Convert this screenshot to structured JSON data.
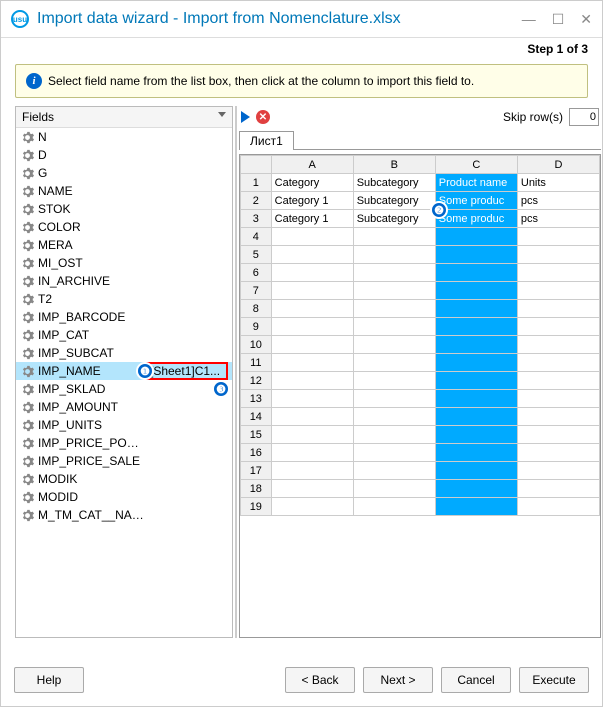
{
  "window": {
    "title": "Import data wizard - Import from Nomenclature.xlsx",
    "step_label": "Step 1 of 3"
  },
  "info_text": "Select field name from the list box, then click at the column to import this field to.",
  "fields": {
    "header": "Fields",
    "items": [
      {
        "name": "N",
        "mapping": ""
      },
      {
        "name": "D",
        "mapping": ""
      },
      {
        "name": "G",
        "mapping": ""
      },
      {
        "name": "NAME",
        "mapping": ""
      },
      {
        "name": "STOK",
        "mapping": ""
      },
      {
        "name": "COLOR",
        "mapping": ""
      },
      {
        "name": "MERA",
        "mapping": ""
      },
      {
        "name": "MI_OST",
        "mapping": ""
      },
      {
        "name": "IN_ARCHIVE",
        "mapping": ""
      },
      {
        "name": "T2",
        "mapping": ""
      },
      {
        "name": "IMP_BARCODE",
        "mapping": ""
      },
      {
        "name": "IMP_CAT",
        "mapping": ""
      },
      {
        "name": "IMP_SUBCAT",
        "mapping": ""
      },
      {
        "name": "IMP_NAME",
        "mapping": "[Sheet1]C1...",
        "selected": true
      },
      {
        "name": "IMP_SKLAD",
        "mapping": ""
      },
      {
        "name": "IMP_AMOUNT",
        "mapping": ""
      },
      {
        "name": "IMP_UNITS",
        "mapping": ""
      },
      {
        "name": "IMP_PRICE_POKUP",
        "mapping": ""
      },
      {
        "name": "IMP_PRICE_SALE",
        "mapping": ""
      },
      {
        "name": "MODIK",
        "mapping": ""
      },
      {
        "name": "MODID",
        "mapping": ""
      },
      {
        "name": "M_TM_CAT__NAME",
        "mapping": ""
      }
    ]
  },
  "toolbar": {
    "skip_label": "Skip row(s)",
    "skip_value": "0"
  },
  "sheet_tab": "Лист1",
  "grid": {
    "cols": [
      "A",
      "B",
      "C",
      "D"
    ],
    "rows": [
      {
        "n": "1",
        "A": "Category",
        "B": "Subcategory",
        "C": "Product name",
        "D": "Units"
      },
      {
        "n": "2",
        "A": "Category 1",
        "B": "Subcategory",
        "C": "Some produc",
        "D": "pcs"
      },
      {
        "n": "3",
        "A": "Category 1",
        "B": "Subcategory",
        "C": "Some produc",
        "D": "pcs"
      },
      {
        "n": "4"
      },
      {
        "n": "5"
      },
      {
        "n": "6"
      },
      {
        "n": "7"
      },
      {
        "n": "8"
      },
      {
        "n": "9"
      },
      {
        "n": "10"
      },
      {
        "n": "11"
      },
      {
        "n": "12"
      },
      {
        "n": "13"
      },
      {
        "n": "14"
      },
      {
        "n": "15"
      },
      {
        "n": "16"
      },
      {
        "n": "17"
      },
      {
        "n": "18"
      },
      {
        "n": "19"
      }
    ],
    "highlight_col": "C"
  },
  "buttons": {
    "help": "Help",
    "back": "< Back",
    "next": "Next >",
    "cancel": "Cancel",
    "execute": "Execute"
  },
  "badges": {
    "b1": "❶",
    "b2": "❷",
    "b3": "❸"
  }
}
